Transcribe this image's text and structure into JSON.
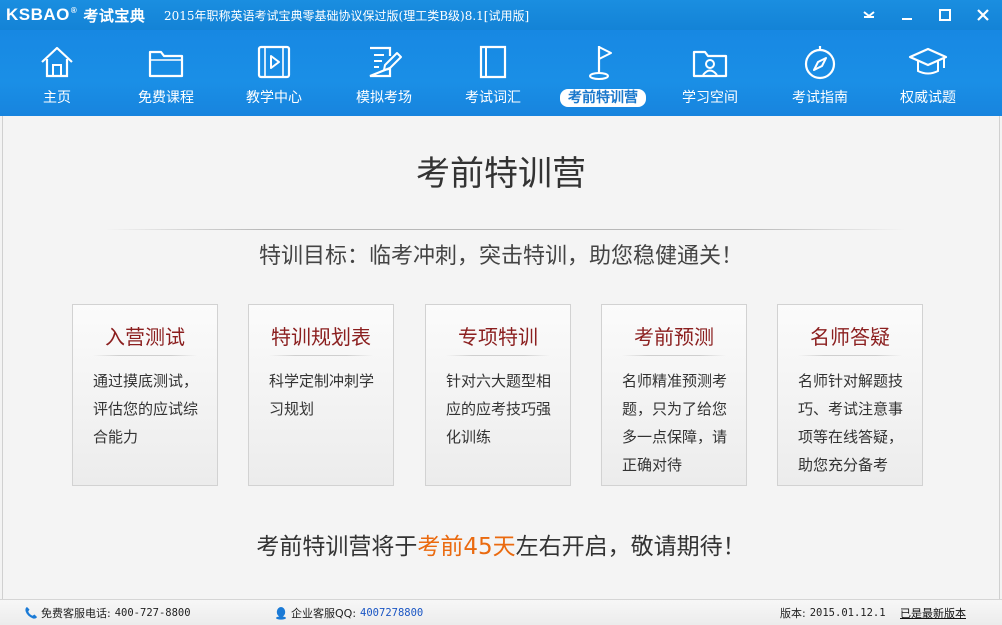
{
  "titlebar": {
    "logo_text": "KSBAO",
    "logo_reg": "®",
    "logo_cn": "考试宝典",
    "title": "2015年职称英语考试宝典零基础协议保过版(理工类B级)8.1[试用版]"
  },
  "nav": {
    "items": [
      {
        "label": "主页",
        "icon": "home-icon"
      },
      {
        "label": "免费课程",
        "icon": "folder-icon"
      },
      {
        "label": "教学中心",
        "icon": "video-icon"
      },
      {
        "label": "模拟考场",
        "icon": "edit-document-icon"
      },
      {
        "label": "考试词汇",
        "icon": "book-icon"
      },
      {
        "label": "考前特训营",
        "icon": "flag-icon",
        "active": true
      },
      {
        "label": "学习空间",
        "icon": "user-folder-icon"
      },
      {
        "label": "考试指南",
        "icon": "compass-icon"
      },
      {
        "label": "权威试题",
        "icon": "graduation-cap-icon"
      }
    ]
  },
  "main": {
    "title": "考前特训营",
    "goal": "特训目标：临考冲刺，突击特训，助您稳健通关！",
    "cards": [
      {
        "title": "入营测试",
        "desc": "通过摸底测试，评估您的应试综合能力"
      },
      {
        "title": "特训规划表",
        "desc": "科学定制冲刺学习规划"
      },
      {
        "title": "专项特训",
        "desc": "针对六大题型相应的应考技巧强化训练"
      },
      {
        "title": "考前预测",
        "desc": "名师精准预测考题，只为了给您多一点保障，请正确对待"
      },
      {
        "title": "名师答疑",
        "desc": "名师针对解题技巧、考试注意事项等在线答疑，助您充分备考"
      }
    ],
    "notice": {
      "before": "考前特训营将于",
      "highlight": "考前45天",
      "after": "左右开启，敬请期待！"
    }
  },
  "status": {
    "phone_label": "免费客服电话:",
    "phone_value": "400-727-8800",
    "qq_label": "企业客服QQ:",
    "qq_value": "4007278800",
    "version_label": "版本:",
    "version_value": "2015.01.12.1",
    "latest_label": "已是最新版本"
  },
  "colors": {
    "brand_blue": "#1a8ee0",
    "card_title": "#8b1f1f",
    "highlight": "#ea6a0f"
  }
}
